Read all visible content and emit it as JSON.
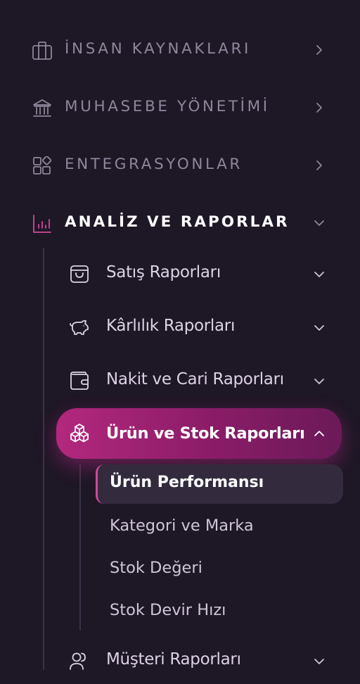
{
  "sections": [
    {
      "label": "İNSAN KAYNAKLARI",
      "icon": "briefcase-icon",
      "expanded": false
    },
    {
      "label": "MUHASEBE YÖNETİMİ",
      "icon": "bank-icon",
      "expanded": false
    },
    {
      "label": "ENTEGRASYONLAR",
      "icon": "apps-icon",
      "expanded": false
    },
    {
      "label": "ANALİZ VE RAPORLAR",
      "icon": "bar-chart-icon",
      "expanded": true
    }
  ],
  "report_groups": [
    {
      "label": "Satış Raporları",
      "icon": "shopping-bag-icon",
      "expanded": false
    },
    {
      "label": "Kârlılık Raporları",
      "icon": "piggy-bank-icon",
      "expanded": false
    },
    {
      "label": "Nakit ve Cari Raporları",
      "icon": "wallet-icon",
      "expanded": false
    },
    {
      "label": "Ürün ve Stok Raporları",
      "icon": "boxes-icon",
      "expanded": true
    },
    {
      "label": "Müşteri Raporları",
      "icon": "users-icon",
      "expanded": false
    }
  ],
  "stock_reports": [
    {
      "label": "Ürün Performansı",
      "active": true
    },
    {
      "label": "Kategori ve Marka",
      "active": false
    },
    {
      "label": "Stok Değeri",
      "active": false
    },
    {
      "label": "Stok Devir Hızı",
      "active": false
    }
  ],
  "colors": {
    "background": "#1e1726",
    "accent": "#b3287e",
    "accent_dark": "#6b1a58",
    "active_indicator": "#d14a9b",
    "section_muted_text": "#8f869b"
  }
}
